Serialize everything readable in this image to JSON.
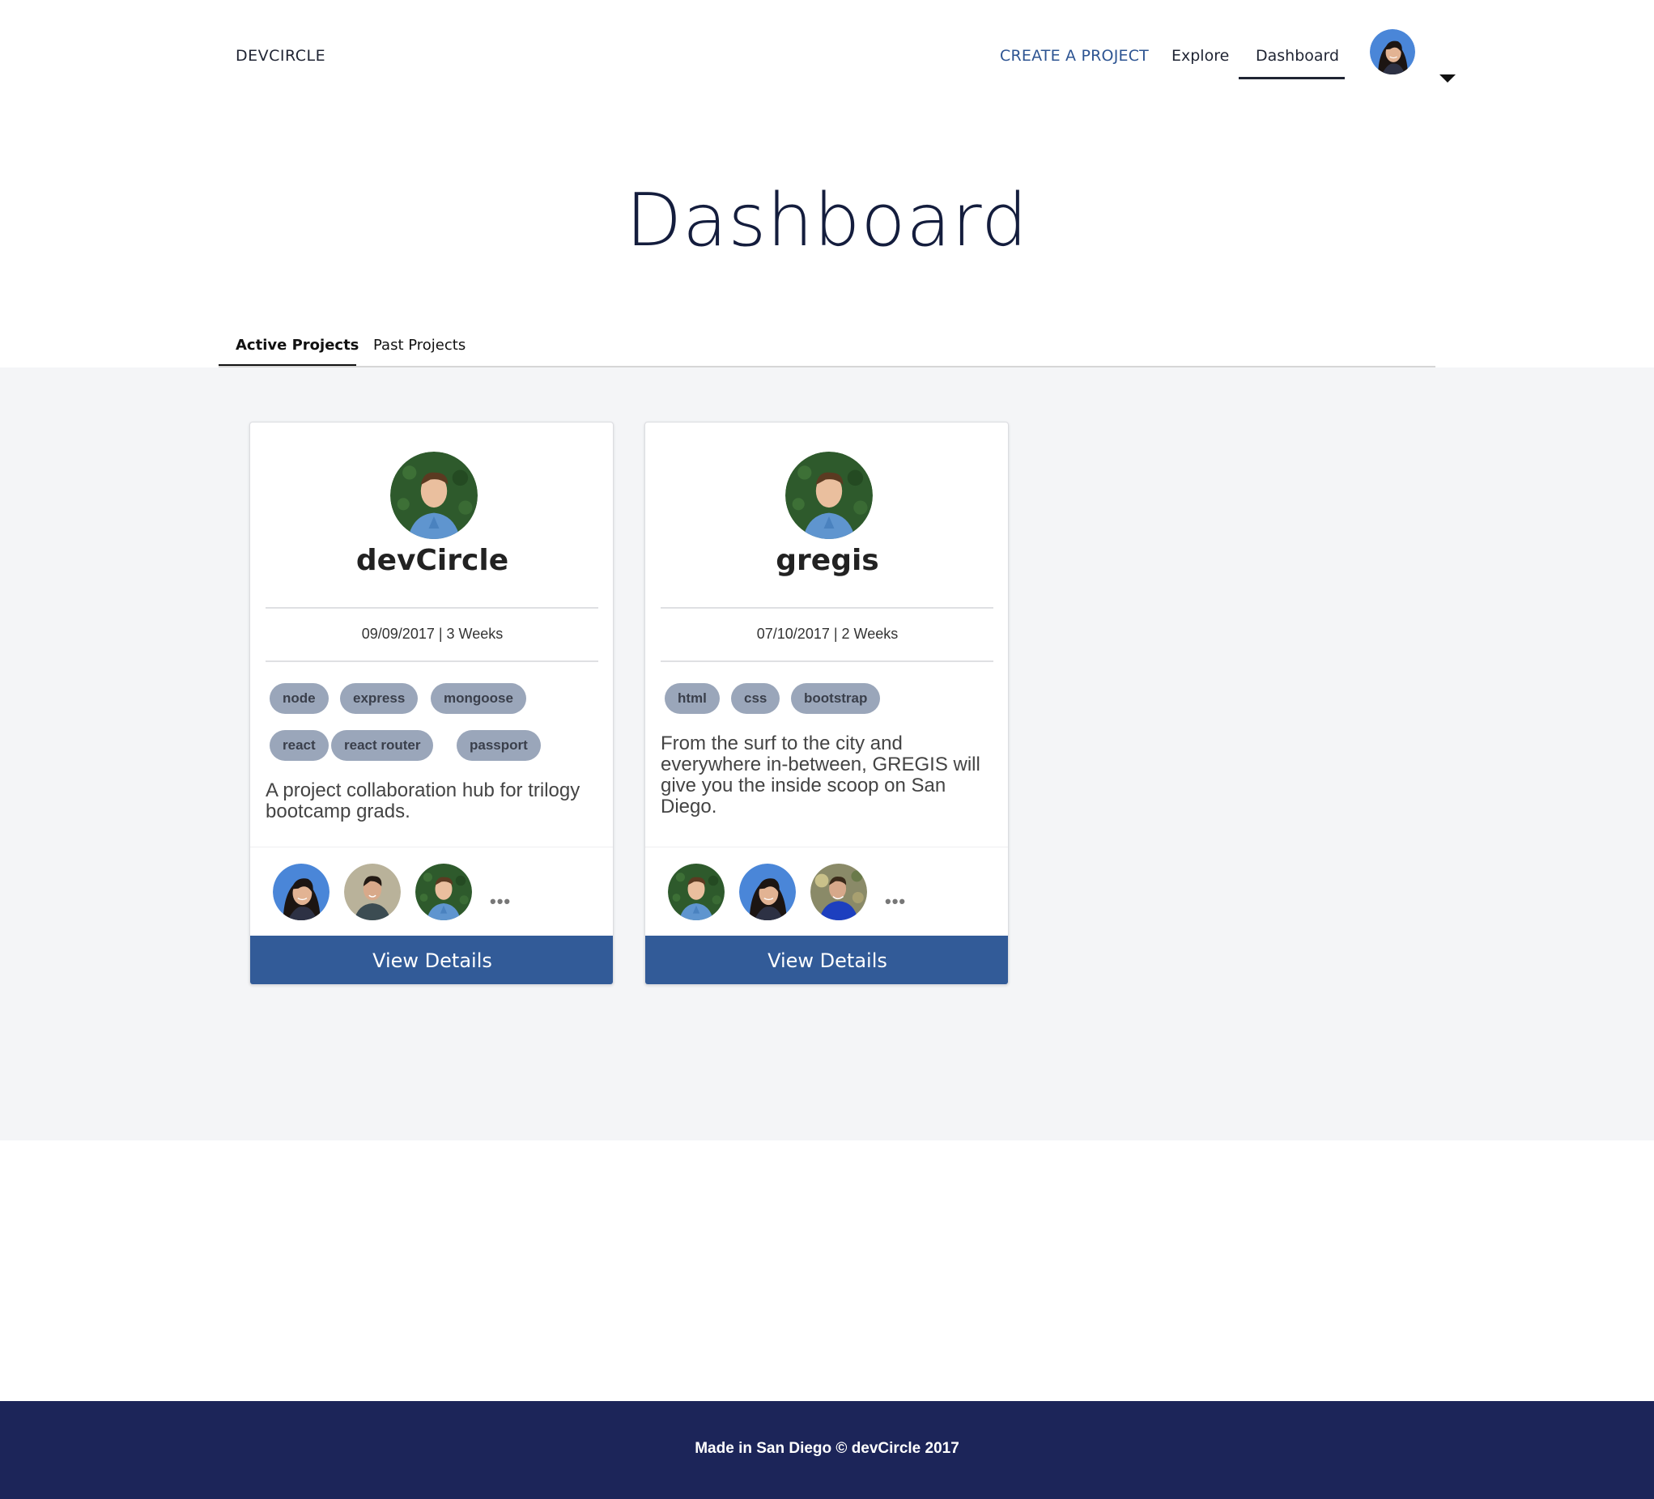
{
  "header": {
    "brand": "DEVCIRCLE",
    "nav": {
      "create": "CREATE A PROJECT",
      "explore": "Explore",
      "dashboard": "Dashboard"
    },
    "avatar_icon": "user-avatar-icon",
    "caret_icon": "caret-down-icon"
  },
  "page": {
    "title": "Dashboard"
  },
  "tabs": {
    "active": "Active Projects",
    "past": "Past Projects"
  },
  "projects": [
    {
      "name": "devCircle",
      "meta": "09/09/2017 | 3 Weeks",
      "tags": [
        "node",
        "express",
        "mongoose",
        "react",
        "react router",
        "passport"
      ],
      "description": "A project collaboration hub for trilogy bootcamp grads.",
      "more": "•••",
      "button": "View Details"
    },
    {
      "name": "gregis",
      "meta": "07/10/2017 | 2 Weeks",
      "tags": [
        "html",
        "css",
        "bootstrap"
      ],
      "description": "From the surf to the city and everywhere in-between, GREGIS will give you the inside scoop on San Diego.",
      "more": "•••",
      "button": "View Details"
    }
  ],
  "footer": {
    "text": "Made in San Diego © devCircle 2017"
  },
  "colors": {
    "primary": "#325b98",
    "navy": "#1c2559",
    "tag_bg": "#9aa6ba",
    "content_bg": "#f4f5f7"
  }
}
